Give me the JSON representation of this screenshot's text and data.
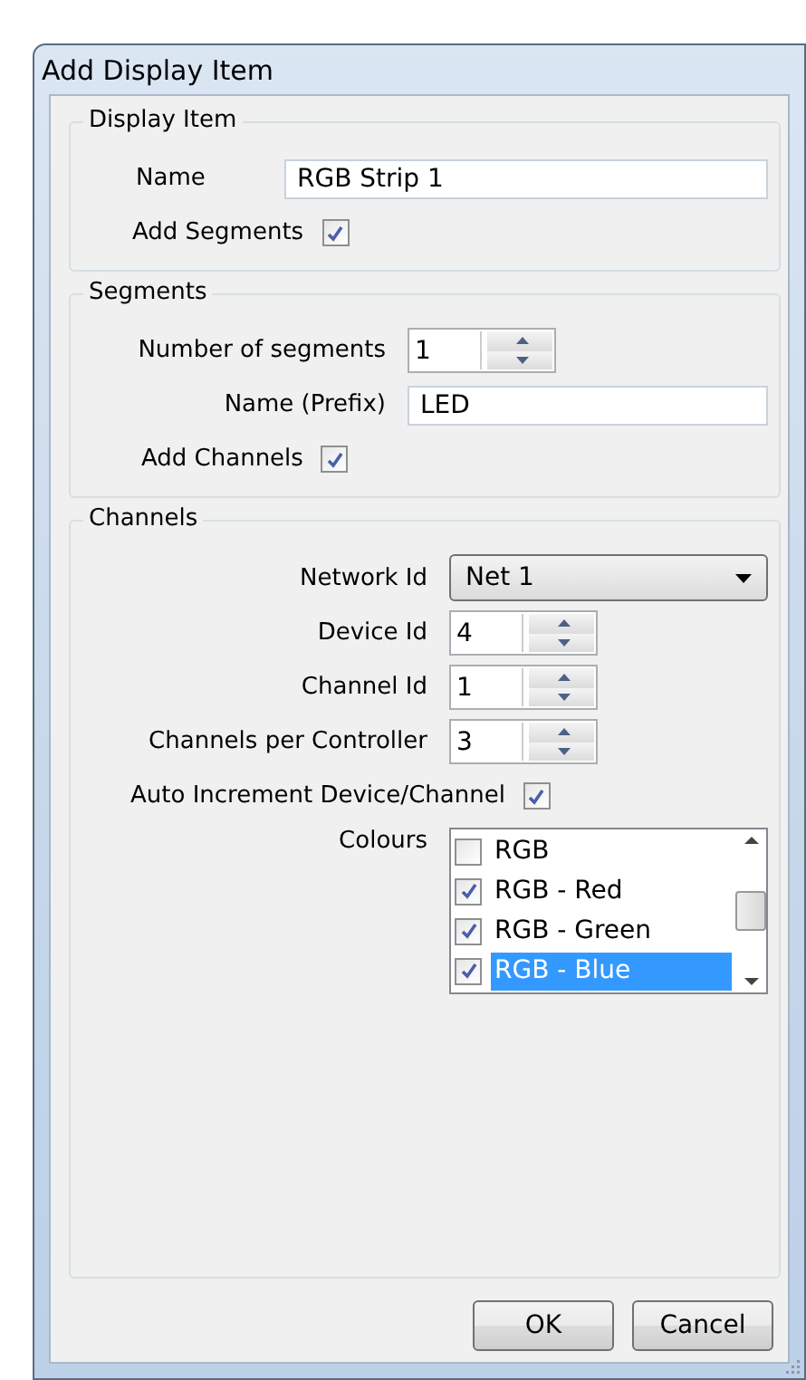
{
  "window": {
    "title": "Add Display Item"
  },
  "groups": [
    {
      "title": "Display Item",
      "rows": [
        {
          "kind": "text",
          "label": "Name",
          "value": "RGB Strip 1"
        },
        {
          "kind": "checkbox",
          "label": "Add Segments",
          "checked": true
        }
      ]
    },
    {
      "title": "Segments",
      "rows": [
        {
          "kind": "spinner",
          "label": "Number of segments",
          "value": "1"
        },
        {
          "kind": "text",
          "label": "Name (Prefix)",
          "value": "LED"
        },
        {
          "kind": "checkbox",
          "label": "Add Channels",
          "checked": true
        }
      ]
    },
    {
      "title": "Channels",
      "rows": [
        {
          "kind": "dropdown",
          "label": "Network Id",
          "value": "Net 1"
        },
        {
          "kind": "spinner",
          "label": "Device Id",
          "value": "4"
        },
        {
          "kind": "spinner",
          "label": "Channel Id",
          "value": "1"
        },
        {
          "kind": "spinner",
          "label": "Channels per Controller",
          "value": "3"
        },
        {
          "kind": "checkbox",
          "label": "Auto Increment Device/Channel",
          "checked": true
        },
        {
          "kind": "checklist",
          "label": "Colours",
          "items": [
            {
              "label": "RGB",
              "checked": false,
              "selected": false
            },
            {
              "label": "RGB - Red",
              "checked": true,
              "selected": false
            },
            {
              "label": "RGB - Green",
              "checked": true,
              "selected": false
            },
            {
              "label": "RGB - Blue",
              "checked": true,
              "selected": true
            }
          ]
        }
      ]
    }
  ],
  "buttons": [
    "OK",
    "Cancel"
  ]
}
